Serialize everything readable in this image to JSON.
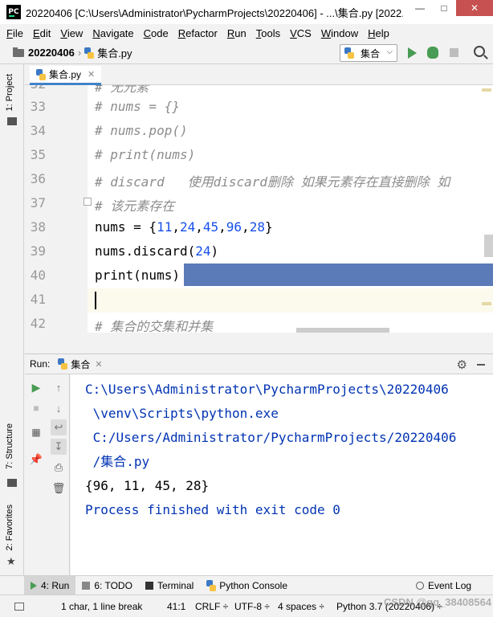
{
  "window": {
    "title": "20220406 [C:\\Users\\Administrator\\PycharmProjects\\20220406] - ...\\集合.py [2022...",
    "app_icon": "PC",
    "controls": [
      "minimize-icon",
      "maximize-icon",
      "close-icon"
    ]
  },
  "menu": [
    "File",
    "Edit",
    "View",
    "Navigate",
    "Code",
    "Refactor",
    "Run",
    "Tools",
    "VCS",
    "Window",
    "Help"
  ],
  "navbar": {
    "project": "20220406",
    "file": "集合.py",
    "run_config": "集合"
  },
  "left_strip": {
    "project_tab": "1: Project",
    "structure_tab": "7: Structure",
    "favorites_tab": "2: Favorites"
  },
  "editor": {
    "tab": "集合.py",
    "lines": [
      {
        "no": "32",
        "text": "# 无元素"
      },
      {
        "no": "33",
        "text": "# nums = {}"
      },
      {
        "no": "34",
        "text": "# nums.pop()"
      },
      {
        "no": "35",
        "text": "# print(nums)"
      },
      {
        "no": "36",
        "text": "# discard   使用discard删除 如果元素存在直接删除 如"
      },
      {
        "no": "37",
        "text": "# 该元素存在"
      },
      {
        "no": "38",
        "text": "nums = {11,24,45,96,28}"
      },
      {
        "no": "39",
        "text": "nums.discard(24)"
      },
      {
        "no": "40",
        "text": "print(nums)"
      },
      {
        "no": "41",
        "text": ""
      },
      {
        "no": "42",
        "text": "# 集合的交集和并集"
      }
    ]
  },
  "run_panel": {
    "label": "Run:",
    "tab": "集合",
    "output": [
      "C:\\Users\\Administrator\\PycharmProjects\\20220406",
      " \\venv\\Scripts\\python.exe",
      " C:/Users/Administrator/PycharmProjects/20220406",
      " /集合.py",
      "{96, 11, 45, 28}",
      "",
      "Process finished with exit code 0"
    ]
  },
  "bottom_tools": {
    "run": "4: Run",
    "todo": "6: TODO",
    "terminal": "Terminal",
    "python_console": "Python Console",
    "event_log": "Event Log"
  },
  "status": {
    "message": "1 char, 1 line break",
    "position": "41:1",
    "line_sep": "CRLF ÷",
    "encoding": "UTF-8 ÷",
    "indent": "4 spaces ÷",
    "interpreter": "Python 3.7 (20220406) ÷"
  },
  "watermark": "CSDN @qq_38408564"
}
